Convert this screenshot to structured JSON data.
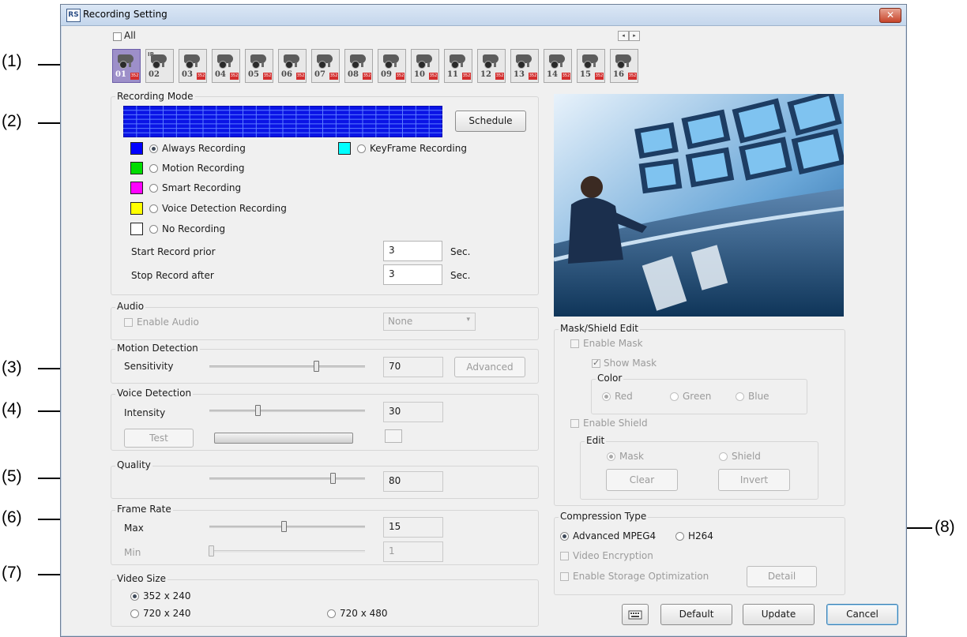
{
  "annotations": [
    "(1)",
    "(2)",
    "(3)",
    "(4)",
    "(5)",
    "(6)",
    "(7)",
    "(8)"
  ],
  "window": {
    "title": "Recording Setting",
    "icon": "app-logo-icon",
    "close": "✕"
  },
  "channels": {
    "all_label": "All",
    "selected": "01",
    "items": [
      {
        "num": "01",
        "badge": "352",
        "ip": ""
      },
      {
        "num": "02",
        "badge": "",
        "ip": "IP"
      },
      {
        "num": "03",
        "badge": "352",
        "ip": ""
      },
      {
        "num": "04",
        "badge": "352",
        "ip": ""
      },
      {
        "num": "05",
        "badge": "352",
        "ip": ""
      },
      {
        "num": "06",
        "badge": "352",
        "ip": ""
      },
      {
        "num": "07",
        "badge": "352",
        "ip": ""
      },
      {
        "num": "08",
        "badge": "352",
        "ip": ""
      },
      {
        "num": "09",
        "badge": "352",
        "ip": ""
      },
      {
        "num": "10",
        "badge": "352",
        "ip": ""
      },
      {
        "num": "11",
        "badge": "352",
        "ip": ""
      },
      {
        "num": "12",
        "badge": "352",
        "ip": ""
      },
      {
        "num": "13",
        "badge": "352",
        "ip": ""
      },
      {
        "num": "14",
        "badge": "352",
        "ip": ""
      },
      {
        "num": "15",
        "badge": "352",
        "ip": ""
      },
      {
        "num": "16",
        "badge": "352",
        "ip": ""
      }
    ],
    "nav_prev": "◂",
    "nav_next": "▸"
  },
  "recording_mode": {
    "title": "Recording Mode",
    "schedule_button": "Schedule",
    "modes": [
      {
        "label": "Always Recording",
        "color": "#0000ff",
        "selected": true
      },
      {
        "label": "Motion Recording",
        "color": "#00dd00",
        "selected": false
      },
      {
        "label": "Smart Recording",
        "color": "#ff00ff",
        "selected": false
      },
      {
        "label": "Voice Detection Recording",
        "color": "#ffff00",
        "selected": false
      },
      {
        "label": "No Recording",
        "color": "#ffffff",
        "selected": false
      },
      {
        "label": "KeyFrame Recording",
        "color": "#00ffff",
        "selected": false
      }
    ],
    "start_prior_label": "Start Record prior",
    "start_prior_value": "3",
    "stop_after_label": "Stop Record after",
    "stop_after_value": "3",
    "unit": "Sec."
  },
  "audio": {
    "title": "Audio",
    "enable_label": "Enable Audio",
    "source_value": "None"
  },
  "motion_detection": {
    "title": "Motion Detection",
    "sensitivity_label": "Sensitivity",
    "sensitivity_value": "70",
    "advanced_button": "Advanced"
  },
  "voice_detection": {
    "title": "Voice Detection",
    "intensity_label": "Intensity",
    "intensity_value": "30",
    "test_button": "Test"
  },
  "quality": {
    "title": "Quality",
    "value": "80"
  },
  "frame_rate": {
    "title": "Frame Rate",
    "max_label": "Max",
    "max_value": "15",
    "min_label": "Min",
    "min_value": "1"
  },
  "video_size": {
    "title": "Video Size",
    "options": [
      {
        "label": "352 x 240",
        "selected": true
      },
      {
        "label": "720 x 240",
        "selected": false
      },
      {
        "label": "720 x 480",
        "selected": false
      }
    ]
  },
  "mask_shield": {
    "title": "Mask/Shield Edit",
    "enable_mask": "Enable Mask",
    "show_mask": "Show Mask",
    "color_title": "Color",
    "colors": [
      {
        "label": "Red",
        "selected": true
      },
      {
        "label": "Green",
        "selected": false
      },
      {
        "label": "Blue",
        "selected": false
      }
    ],
    "enable_shield": "Enable Shield",
    "edit_title": "Edit",
    "edit_options": [
      {
        "label": "Mask",
        "selected": true
      },
      {
        "label": "Shield",
        "selected": false
      }
    ],
    "clear_button": "Clear",
    "invert_button": "Invert"
  },
  "compression": {
    "title": "Compression Type",
    "options": [
      {
        "label": "Advanced MPEG4",
        "selected": true
      },
      {
        "label": "H264",
        "selected": false
      }
    ],
    "video_encryption": "Video Encryption",
    "storage_optimization": "Enable Storage Optimization",
    "detail_button": "Detail"
  },
  "footer": {
    "keyboard_icon": "keyboard-icon",
    "default_button": "Default",
    "update_button": "Update",
    "cancel_button": "Cancel"
  }
}
